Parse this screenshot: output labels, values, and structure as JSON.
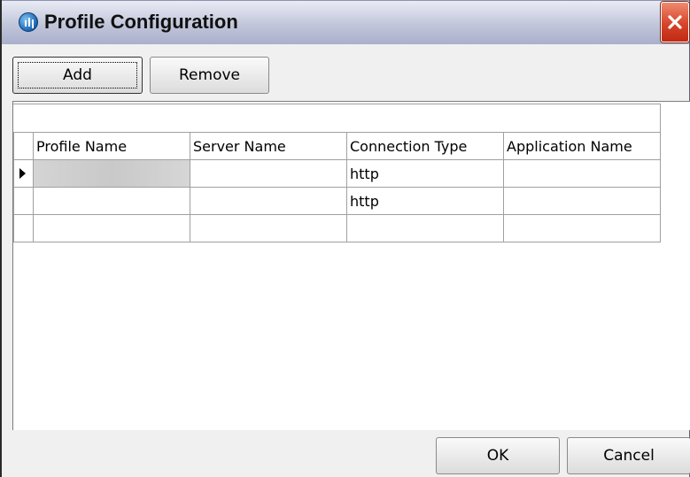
{
  "window": {
    "title": "Profile Configuration"
  },
  "toolbar": {
    "add_label": "Add",
    "remove_label": "Remove"
  },
  "grid": {
    "columns": [
      "Profile Name",
      "Server Name",
      "Connection Type",
      "Application Name"
    ],
    "rows": [
      {
        "profile_name": "",
        "server_name": "",
        "connection_type": "http",
        "application_name": ""
      },
      {
        "profile_name": "",
        "server_name": "",
        "connection_type": "http",
        "application_name": ""
      },
      {
        "profile_name": "",
        "server_name": "",
        "connection_type": "",
        "application_name": ""
      }
    ]
  },
  "footer": {
    "ok_label": "OK",
    "cancel_label": "Cancel"
  },
  "icons": {
    "app": "app-logo-icon",
    "close": "close-icon",
    "row_selector": "row-pointer-icon"
  },
  "colors": {
    "close_button": "#d6442a",
    "titlebar": "#c1c6da",
    "grid_border": "#a0a0a0"
  }
}
